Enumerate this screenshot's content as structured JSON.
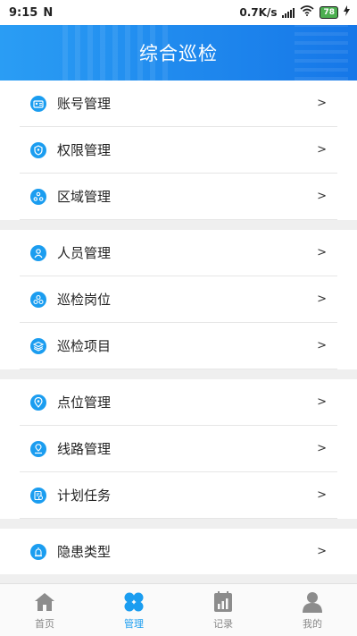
{
  "status_bar": {
    "time": "9:15",
    "notif": "N",
    "speed": "0.7K/s",
    "battery": "78"
  },
  "header": {
    "title": "综合巡检"
  },
  "groups": [
    {
      "items": [
        {
          "label": "账号管理",
          "icon": "account-icon"
        },
        {
          "label": "权限管理",
          "icon": "permission-shield-icon"
        },
        {
          "label": "区域管理",
          "icon": "area-icon"
        }
      ]
    },
    {
      "items": [
        {
          "label": "人员管理",
          "icon": "person-icon"
        },
        {
          "label": "巡检岗位",
          "icon": "post-icon"
        },
        {
          "label": "巡检项目",
          "icon": "project-layers-icon"
        }
      ]
    },
    {
      "items": [
        {
          "label": "点位管理",
          "icon": "location-pin-icon"
        },
        {
          "label": "线路管理",
          "icon": "route-icon"
        },
        {
          "label": "计划任务",
          "icon": "plan-task-icon"
        }
      ]
    },
    {
      "items": [
        {
          "label": "隐患类型",
          "icon": "hazard-icon"
        }
      ]
    }
  ],
  "arrow": ">",
  "tabs": [
    {
      "label": "首页",
      "icon": "home-icon",
      "active": false
    },
    {
      "label": "管理",
      "icon": "manage-grid-icon",
      "active": true
    },
    {
      "label": "记录",
      "icon": "records-icon",
      "active": false
    },
    {
      "label": "我的",
      "icon": "profile-icon",
      "active": false
    }
  ],
  "colors": {
    "accent": "#1b9df0",
    "header_start": "#2a9df4",
    "header_end": "#1677e8",
    "inactive_tab": "#888888"
  }
}
